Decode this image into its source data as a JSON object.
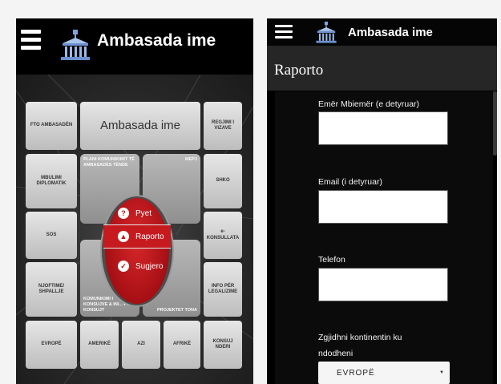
{
  "app": {
    "title": "Ambasada ime",
    "accent_color": "#c61a1f"
  },
  "left": {
    "logo_title": "Ambasada ime",
    "tiles": {
      "fto": "FTO AMBASADËN",
      "center_title": "Ambasada ime",
      "regjimi": "REGJIMI I VIZAVE",
      "mbulimi": "MBULIMI DIPLOMATIK",
      "shko": "SHKO",
      "sos": "SOS",
      "ekonsullata": "e-KONSULLATA",
      "njoftime": "NJOFTIME/ SHPALLJE",
      "info": "INFO PËR LEGALIZIME",
      "evrope": "EVROPË",
      "amerike": "AMERIKË",
      "azi": "AZI",
      "afrike": "AFRIKË",
      "konsuj": "KONSUJ NDERI"
    },
    "mid_tiles": {
      "plani": "PLANI KOMUNIKIMIT TË AMBASADËS TËNDE",
      "mepj": "MEPJ",
      "komunikimi": "KOMUNIKIMI I KONSUJVE & INI... PËR KONSUJT",
      "projektet": "PROJEKTET TONA"
    },
    "menu": {
      "pyet": "Pyet",
      "raporto": "Raporto",
      "sugjero": "Sugjero"
    }
  },
  "right": {
    "logo_title": "Ambasada ime",
    "section_title": "Raporto",
    "form": {
      "name_label": "Emër Mbiemër (e detyruar)",
      "email_label": "Email (i detyruar)",
      "phone_label": "Telefon",
      "continent_label": "Zgjidhni kontinentin ku ndodheni",
      "continent_value": "EVROPË"
    }
  }
}
